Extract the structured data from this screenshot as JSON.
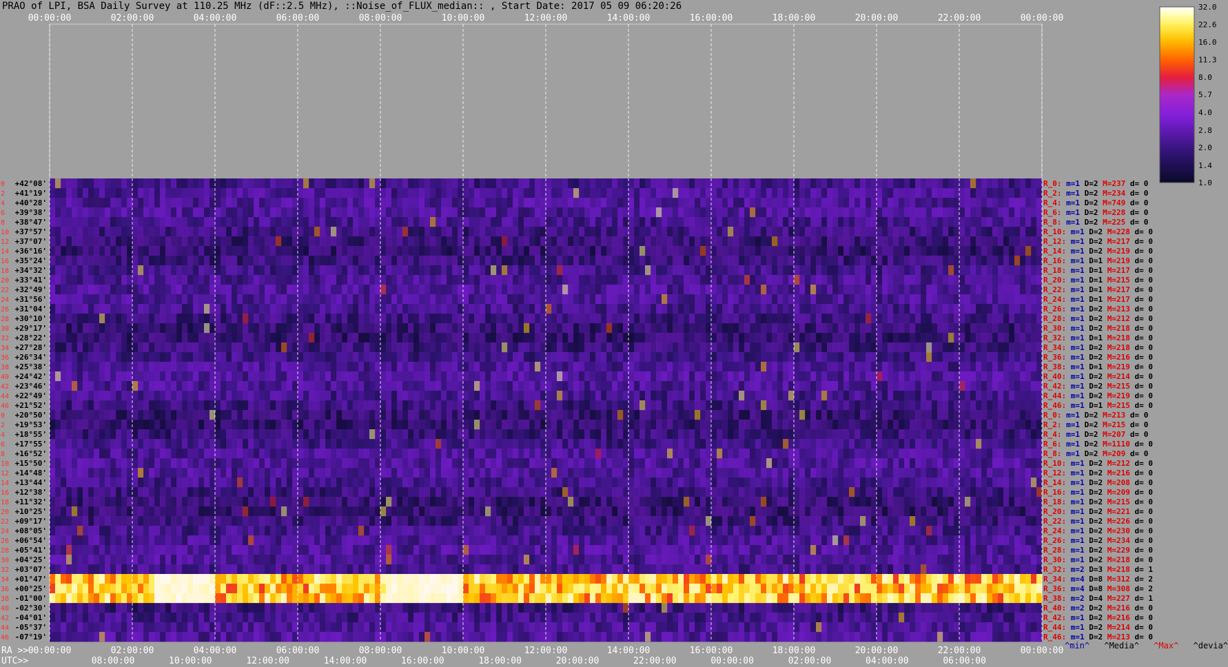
{
  "title": "PRAO of LPI, BSA Daily Survey at 110.25 MHz (dF::2.5 MHz), ::Noise_of_FLUX_median:: , Start Date: 2017 05 09 06:20:26",
  "row_prefix_ra": "RA >>",
  "row_prefix_utc": "UTC>>",
  "legend_keys": [
    {
      "label": "^min^",
      "color": "#0000aa"
    },
    {
      "label": "^Media^",
      "color": "#000000"
    },
    {
      "label": "^Max^",
      "color": "#e00000"
    },
    {
      "label": "^devia^",
      "color": "#000000"
    }
  ],
  "chart_data": {
    "type": "heatmap",
    "colorbar_ticks": [
      "32.0",
      "22.6",
      "16.0",
      "11.3",
      "8.0",
      "5.7",
      "4.0",
      "2.8",
      "2.0",
      "1.4",
      "1.0"
    ],
    "colorbar_range": [
      1.0,
      32.0
    ],
    "colorbar_scale": "log",
    "top_axis_ticks": [
      "00:00:00",
      "02:00:00",
      "04:00:00",
      "06:00:00",
      "08:00:00",
      "10:00:00",
      "12:00:00",
      "14:00:00",
      "16:00:00",
      "18:00:00",
      "20:00:00",
      "22:00:00",
      "00:00:00"
    ],
    "ra_axis_ticks": [
      "00:00:00",
      "02:00:00",
      "04:00:00",
      "06:00:00",
      "08:00:00",
      "10:00:00",
      "12:00:00",
      "14:00:00",
      "16:00:00",
      "18:00:00",
      "20:00:00",
      "22:00:00",
      "00:00:00"
    ],
    "utc_axis_ticks": [
      "08:00:00",
      "10:00:00",
      "12:00:00",
      "14:00:00",
      "16:00:00",
      "18:00:00",
      "20:00:00",
      "22:00:00",
      "00:00:00",
      "02:00:00",
      "04:00:00",
      "06:00:00"
    ],
    "declination_labels": [
      "+42°08'",
      "+41°19'",
      "+40°28'",
      "+39°38'",
      "+38°47'",
      "+37°57'",
      "+37°07'",
      "+36°16'",
      "+35°24'",
      "+34°32'",
      "+33°41'",
      "+32°49'",
      "+31°56'",
      "+31°04'",
      "+30°10'",
      "+29°17'",
      "+28°22'",
      "+27°28'",
      "+26°34'",
      "+25°38'",
      "+24°42'",
      "+23°46'",
      "+22°49'",
      "+21°52'",
      "+20°50'",
      "+19°53'",
      "+18°55'",
      "+17°55'",
      "+16°52'",
      "+15°50'",
      "+14°48'",
      "+13°44'",
      "+12°38'",
      "+11°32'",
      "+10°25'",
      "+09°17'",
      "+08°05'",
      "+06°54'",
      "+05°41'",
      "+04°25'",
      "+03°07'",
      "+01°47'",
      "+00°25'",
      "-01°00'",
      "-02°30'",
      "-04°01'",
      "-05°37'",
      "-07°19'"
    ],
    "row_index_labels": [
      "0",
      "2",
      "4",
      "6",
      "8",
      "10",
      "12",
      "14",
      "16",
      "18",
      "20",
      "22",
      "24",
      "26",
      "28",
      "30",
      "32",
      "34",
      "36",
      "38",
      "40",
      "42",
      "44",
      "46",
      "0",
      "2",
      "4",
      "6",
      "8",
      "10",
      "12",
      "14",
      "16",
      "18",
      "20",
      "22",
      "24",
      "26",
      "28",
      "30",
      "32",
      "34",
      "36",
      "38",
      "40",
      "42",
      "44",
      "46"
    ],
    "row_stats": [
      {
        "r": "R_0:",
        "m": "m=1",
        "d": "D=2",
        "max": "M=237",
        "dev": "d= 0"
      },
      {
        "r": "R_2:",
        "m": "m=1",
        "d": "D=2",
        "max": "M=234",
        "dev": "d= 0"
      },
      {
        "r": "R_4:",
        "m": "m=1",
        "d": "D=2",
        "max": "M=749",
        "dev": "d= 0"
      },
      {
        "r": "R_6:",
        "m": "m=1",
        "d": "D=2",
        "max": "M=228",
        "dev": "d= 0"
      },
      {
        "r": "R_8:",
        "m": "m=1",
        "d": "D=2",
        "max": "M=225",
        "dev": "d= 0"
      },
      {
        "r": "R_10:",
        "m": "m=1",
        "d": "D=2",
        "max": "M=228",
        "dev": "d= 0"
      },
      {
        "r": "R_12:",
        "m": "m=1",
        "d": "D=2",
        "max": "M=217",
        "dev": "d= 0"
      },
      {
        "r": "R_14:",
        "m": "m=1",
        "d": "D=2",
        "max": "M=219",
        "dev": "d= 0"
      },
      {
        "r": "R_16:",
        "m": "m=1",
        "d": "D=1",
        "max": "M=219",
        "dev": "d= 0"
      },
      {
        "r": "R_18:",
        "m": "m=1",
        "d": "D=1",
        "max": "M=217",
        "dev": "d= 0"
      },
      {
        "r": "R_20:",
        "m": "m=1",
        "d": "D=1",
        "max": "M=215",
        "dev": "d= 0"
      },
      {
        "r": "R_22:",
        "m": "m=1",
        "d": "D=1",
        "max": "M=217",
        "dev": "d= 0"
      },
      {
        "r": "R_24:",
        "m": "m=1",
        "d": "D=1",
        "max": "M=217",
        "dev": "d= 0"
      },
      {
        "r": "R_26:",
        "m": "m=1",
        "d": "D=2",
        "max": "M=213",
        "dev": "d= 0"
      },
      {
        "r": "R_28:",
        "m": "m=1",
        "d": "D=2",
        "max": "M=212",
        "dev": "d= 0"
      },
      {
        "r": "R_30:",
        "m": "m=1",
        "d": "D=2",
        "max": "M=218",
        "dev": "d= 0"
      },
      {
        "r": "R_32:",
        "m": "m=1",
        "d": "D=1",
        "max": "M=218",
        "dev": "d= 0"
      },
      {
        "r": "R_34:",
        "m": "m=1",
        "d": "D=2",
        "max": "M=218",
        "dev": "d= 0"
      },
      {
        "r": "R_36:",
        "m": "m=1",
        "d": "D=2",
        "max": "M=216",
        "dev": "d= 0"
      },
      {
        "r": "R_38:",
        "m": "m=1",
        "d": "D=1",
        "max": "M=219",
        "dev": "d= 0"
      },
      {
        "r": "R_40:",
        "m": "m=1",
        "d": "D=2",
        "max": "M=214",
        "dev": "d= 0"
      },
      {
        "r": "R_42:",
        "m": "m=1",
        "d": "D=2",
        "max": "M=215",
        "dev": "d= 0"
      },
      {
        "r": "R_44:",
        "m": "m=1",
        "d": "D=2",
        "max": "M=219",
        "dev": "d= 0"
      },
      {
        "r": "R_46:",
        "m": "m=1",
        "d": "D=1",
        "max": "M=215",
        "dev": "d= 0"
      },
      {
        "r": "R_0:",
        "m": "m=1",
        "d": "D=2",
        "max": "M=213",
        "dev": "d= 0"
      },
      {
        "r": "R_2:",
        "m": "m=1",
        "d": "D=2",
        "max": "M=215",
        "dev": "d= 0"
      },
      {
        "r": "R_4:",
        "m": "m=1",
        "d": "D=2",
        "max": "M=207",
        "dev": "d= 0"
      },
      {
        "r": "R_6:",
        "m": "m=1",
        "d": "D=2",
        "max": "M=1110",
        "dev": "d= 0"
      },
      {
        "r": "R_8:",
        "m": "m=1",
        "d": "D=2",
        "max": "M=209",
        "dev": "d= 0"
      },
      {
        "r": "R_10:",
        "m": "m=1",
        "d": "D=2",
        "max": "M=212",
        "dev": "d= 0"
      },
      {
        "r": "R_12:",
        "m": "m=1",
        "d": "D=2",
        "max": "M=216",
        "dev": "d= 0"
      },
      {
        "r": "R_14:",
        "m": "m=1",
        "d": "D=2",
        "max": "M=208",
        "dev": "d= 0"
      },
      {
        "r": "R_16:",
        "m": "m=1",
        "d": "D=2",
        "max": "M=209",
        "dev": "d= 0"
      },
      {
        "r": "R_18:",
        "m": "m=1",
        "d": "D=2",
        "max": "M=215",
        "dev": "d= 0"
      },
      {
        "r": "R_20:",
        "m": "m=1",
        "d": "D=2",
        "max": "M=221",
        "dev": "d= 0"
      },
      {
        "r": "R_22:",
        "m": "m=1",
        "d": "D=2",
        "max": "M=226",
        "dev": "d= 0"
      },
      {
        "r": "R_24:",
        "m": "m=1",
        "d": "D=2",
        "max": "M=230",
        "dev": "d= 0"
      },
      {
        "r": "R_26:",
        "m": "m=1",
        "d": "D=2",
        "max": "M=234",
        "dev": "d= 0"
      },
      {
        "r": "R_28:",
        "m": "m=1",
        "d": "D=2",
        "max": "M=229",
        "dev": "d= 0"
      },
      {
        "r": "R_30:",
        "m": "m=1",
        "d": "D=2",
        "max": "M=218",
        "dev": "d= 0"
      },
      {
        "r": "R_32:",
        "m": "m=2",
        "d": "D=3",
        "max": "M=218",
        "dev": "d= 1"
      },
      {
        "r": "R_34:",
        "m": "m=4",
        "d": "D=8",
        "max": "M=312",
        "dev": "d= 2"
      },
      {
        "r": "R_36:",
        "m": "m=4",
        "d": "D=8",
        "max": "M=308",
        "dev": "d= 2"
      },
      {
        "r": "R_38:",
        "m": "m=2",
        "d": "D=4",
        "max": "M=227",
        "dev": "d= 1"
      },
      {
        "r": "R_40:",
        "m": "m=2",
        "d": "D=2",
        "max": "M=216",
        "dev": "d= 0"
      },
      {
        "r": "R_42:",
        "m": "m=1",
        "d": "D=2",
        "max": "M=216",
        "dev": "d= 0"
      },
      {
        "r": "R_44:",
        "m": "m=1",
        "d": "D=2",
        "max": "M=214",
        "dev": "d= 0"
      },
      {
        "r": "R_46:",
        "m": "m=1",
        "d": "D=2",
        "max": "M=213",
        "dev": "d= 0"
      }
    ],
    "bright_band": {
      "from_dec": "+01°47'",
      "to_dec": "-01°00'",
      "peak_value": 32.0
    }
  }
}
